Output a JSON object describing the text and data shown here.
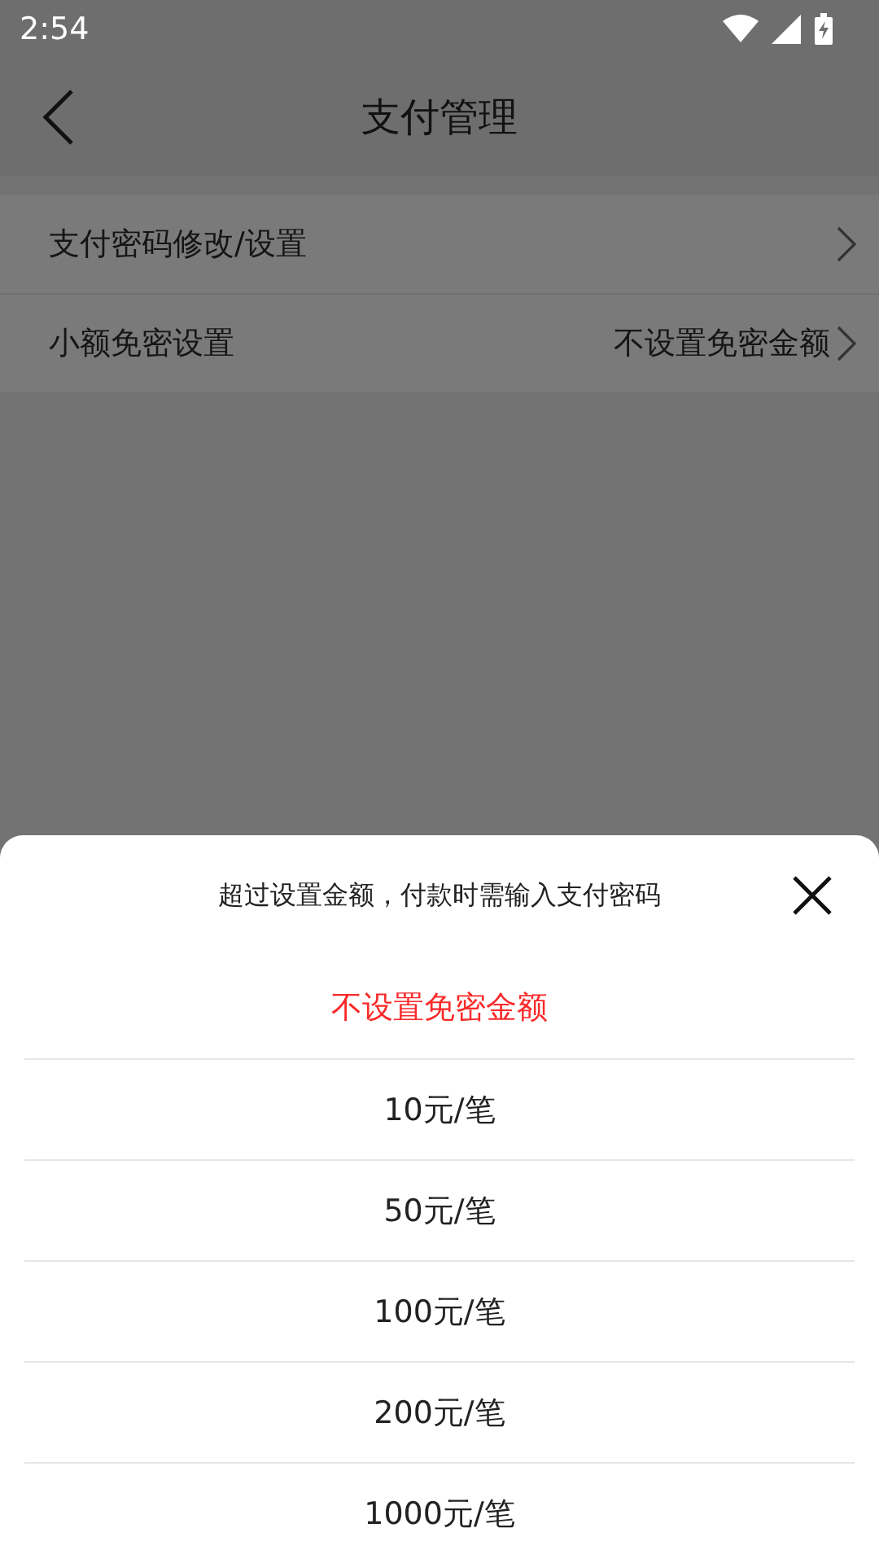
{
  "status_bar": {
    "time": "2:54"
  },
  "header": {
    "title": "支付管理"
  },
  "settings": [
    {
      "label": "支付密码修改/设置"
    },
    {
      "label": "小额免密设置",
      "value": "不设置免密金额"
    }
  ],
  "sheet": {
    "title": "超过设置金额，付款时需输入支付密码",
    "options": [
      {
        "label": "不设置免密金额",
        "selected": true
      },
      {
        "label": "10元/笔",
        "selected": false
      },
      {
        "label": "50元/笔",
        "selected": false
      },
      {
        "label": "100元/笔",
        "selected": false
      },
      {
        "label": "200元/笔",
        "selected": false
      },
      {
        "label": "1000元/笔",
        "selected": false
      }
    ]
  }
}
